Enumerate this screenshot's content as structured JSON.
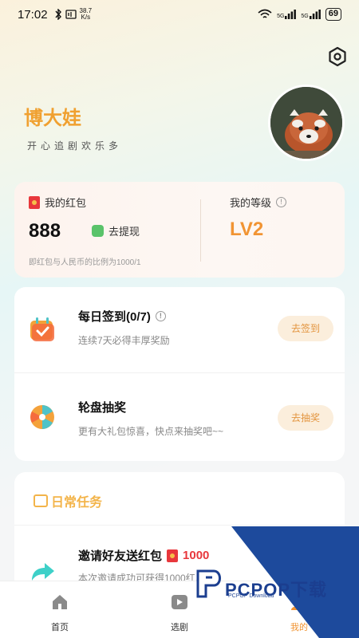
{
  "status_bar": {
    "time": "17:02",
    "speed_value": "38.7",
    "speed_unit": "K/s",
    "battery": "69",
    "signal1_label": "5G",
    "signal2_label": "5G"
  },
  "profile": {
    "name": "博大娃",
    "slogan": "开心追剧欢乐多"
  },
  "wallet": {
    "title": "我的红包",
    "amount": "888",
    "withdraw_label": "去提现",
    "ratio_text": "即红包与人民币的比例为1000/1",
    "level_title": "我的等级",
    "level_value": "LV2"
  },
  "tasks": [
    {
      "title": "每日签到(0/7)",
      "desc": "连续7天必得丰厚奖励",
      "button": "去签到"
    },
    {
      "title": "轮盘抽奖",
      "desc": "更有大礼包惊喜，快点来抽奖吧~~",
      "button": "去抽奖"
    }
  ],
  "daily": {
    "header": "日常任务",
    "invite_title": "邀请好友送红包",
    "invite_amount": "1000",
    "invite_desc": "本次邀请成功可获得1000红..."
  },
  "tabbar": [
    {
      "label": "首页",
      "icon": "home-icon"
    },
    {
      "label": "选剧",
      "icon": "video-icon"
    },
    {
      "label": "我的",
      "icon": "profile-icon"
    }
  ],
  "watermark": {
    "brand": "PCPOP下载",
    "sub": "PCPOP Download"
  },
  "colors": {
    "accent_orange": "#f19433",
    "name_orange": "#f0a030",
    "red": "#e8373c",
    "green": "#5ac36a"
  }
}
